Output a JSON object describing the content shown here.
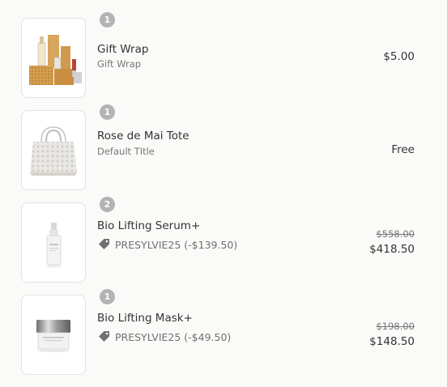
{
  "items": [
    {
      "name": "Gift Wrap",
      "variant": "Gift Wrap",
      "quantity": "1",
      "price": "$5.00",
      "image_icon": "gift-set-image"
    },
    {
      "name": "Rose de Mai Tote",
      "variant": "Default TItle",
      "quantity": "1",
      "price": "Free",
      "image_icon": "tote-bag-image"
    },
    {
      "name": "Bio Lifting Serum+",
      "quantity": "2",
      "discount_code": "PRESYLVIE25 (-$139.50)",
      "compare_price": "$558.00",
      "price": "$418.50",
      "image_icon": "serum-bottle-image"
    },
    {
      "name": "Bio Lifting Mask+",
      "quantity": "1",
      "discount_code": "PRESYLVIE25 (-$49.50)",
      "compare_price": "$198.00",
      "price": "$148.50",
      "image_icon": "mask-jar-image"
    }
  ],
  "colors": {
    "background": "#fafaf8",
    "badge": "#b3b3b3",
    "text": "#333333",
    "muted": "#777777"
  }
}
